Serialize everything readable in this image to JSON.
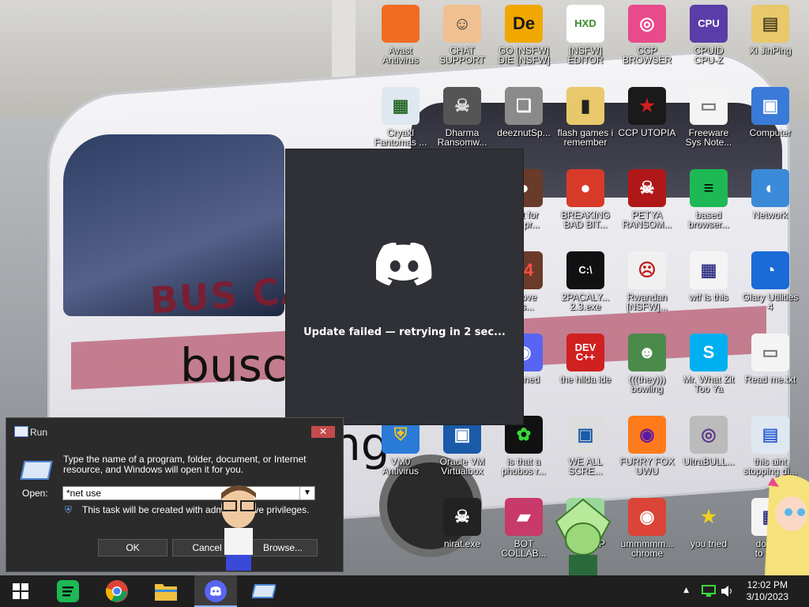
{
  "desktop": {
    "wallpaper_texts": {
      "bus_name": "BUS CAR",
      "line1": "busca",
      "line2": "ng"
    },
    "icons": [
      {
        "name": "avast-antivirus",
        "label": "Avast\nAntivirus",
        "glyph": "",
        "bg": "#f26b21",
        "fg": "#ffffff"
      },
      {
        "name": "chat-support",
        "label": "CHAT\nSUPPORT",
        "glyph": "☺",
        "bg": "#f0c090",
        "fg": "#333333"
      },
      {
        "name": "go-die",
        "label": "GO [NSFW]\nDIE [NSFW]",
        "glyph": "De",
        "bg": "#f0a800",
        "fg": "#1a1a1a"
      },
      {
        "name": "hex-editor",
        "label": "[NSFW] EDITOR",
        "glyph": "HXD",
        "bg": "#ffffff",
        "fg": "#3a8a2a"
      },
      {
        "name": "ccp-browser",
        "label": "CCP\nBROWSER",
        "glyph": "◎",
        "bg": "#e84a8a",
        "fg": "#ffffff"
      },
      {
        "name": "cpuid-cpu-z",
        "label": "CPUID\nCPU-Z",
        "glyph": "CPU",
        "bg": "#5a3da8",
        "fg": "#ffffff"
      },
      {
        "name": "xi-jinping",
        "label": "Xi JinPing",
        "glyph": "▤",
        "bg": "#e8c86a",
        "fg": "#5a4a2a"
      },
      {
        "name": "cryakl-fantomas",
        "label": "Cryakl\nFantomas ...",
        "glyph": "▦",
        "bg": "#dfe8f0",
        "fg": "#2a6a2a"
      },
      {
        "name": "dharma-ransomware",
        "label": "Dharma\nRansomw...",
        "glyph": "☠",
        "bg": "#555555",
        "fg": "#dddddd"
      },
      {
        "name": "deeznutsp",
        "label": "deeznutSp...",
        "glyph": "❏",
        "bg": "#8a8a8a",
        "fg": "#ffffff"
      },
      {
        "name": "flash-games",
        "label": "flash games i\nremember",
        "glyph": "▮",
        "bg": "#e8c86a",
        "fg": "#222222"
      },
      {
        "name": "ccp-utopia",
        "label": "CCP UTOPIA",
        "glyph": "★",
        "bg": "#1a1a1a",
        "fg": "#d02020"
      },
      {
        "name": "freeware-sys-note",
        "label": "Freeware\nSys Note...",
        "glyph": "▭",
        "bg": "#f4f4f4",
        "fg": "#777777"
      },
      {
        "name": "computer",
        "label": "Computer",
        "glyph": "▣",
        "bg": "#3a7ad8",
        "fg": "#ffffff"
      },
      {
        "name": "butt-for-the-pr",
        "label": "butt for\nthe pr...",
        "glyph": "●",
        "bg": "#6a3a2a",
        "fg": "#ffffff"
      },
      {
        "name": "breaking-bad-bit",
        "label": "BREAKING\nBAD BIT...",
        "glyph": "●",
        "bg": "#d83a2a",
        "fg": "#ffffff"
      },
      {
        "name": "petya-ransom",
        "label": "PETYA\nRANSOM...",
        "glyph": "☠",
        "bg": "#b01818",
        "fg": "#ffffff"
      },
      {
        "name": "based-browser",
        "label": "based\nbrowser...",
        "glyph": "≡",
        "bg": "#1db954",
        "fg": "#000000"
      },
      {
        "name": "network",
        "label": "Network",
        "glyph": "◐",
        "bg": "#3a8ad8",
        "fg": "#ffffff"
      },
      {
        "name": "above-s",
        "label": "above\no s...",
        "glyph": "64",
        "bg": "#6a3a2a",
        "fg": "#ff5040"
      },
      {
        "name": "2pacaly",
        "label": "2PACALY...\n2.3.exe",
        "glyph": "C:\\",
        "bg": "#111111",
        "fg": "#ffffff"
      },
      {
        "name": "rwandan-genocide",
        "label": "Rwandan\n[NSFW]...",
        "glyph": "☹",
        "bg": "#f0f0f0",
        "fg": "#c02020"
      },
      {
        "name": "wtf-is-this",
        "label": "wtf is this",
        "glyph": "▦",
        "bg": "#f4f4f4",
        "fg": "#3a3a8a"
      },
      {
        "name": "glary-utilities",
        "label": "Glary Utilities\n4",
        "glyph": "◔",
        "bg": "#1a6ad8",
        "fg": "#ffffff"
      },
      {
        "name": "banned",
        "label": "banned",
        "glyph": "◉",
        "bg": "#5865f2",
        "fg": "#ffffff"
      },
      {
        "name": "the-hilda-ide",
        "label": "the hilda ide",
        "glyph": "DEV\nC++",
        "bg": "#d02020",
        "fg": "#ffffff"
      },
      {
        "name": "they-bowling",
        "label": "(((they)))\nbowling",
        "glyph": "☻",
        "bg": "#4a8a4a",
        "fg": "#ffffff"
      },
      {
        "name": "mr-what-zit-too-ya",
        "label": "Mr. What Zit\nToo Ya",
        "glyph": "S",
        "bg": "#00aff0",
        "fg": "#ffffff"
      },
      {
        "name": "read-me-txt",
        "label": "Read me.txt",
        "glyph": "▭",
        "bg": "#f4f4f4",
        "fg": "#777777"
      },
      {
        "name": "vm0-antivirus",
        "label": "VM0\nAntivirus",
        "glyph": "⛨",
        "bg": "#2a7ad8",
        "fg": "#f0c020"
      },
      {
        "name": "oracle-vm-virtualbox",
        "label": "Oracle VM\nVirtualbox",
        "glyph": "▣",
        "bg": "#1a5aa8",
        "fg": "#ffffff"
      },
      {
        "name": "is-that-a-phobos",
        "label": "is that a\nphobos r...",
        "glyph": "✿",
        "bg": "#111111",
        "fg": "#3ad83a"
      },
      {
        "name": "we-all-scre",
        "label": "WE ALL\nSCRE...",
        "glyph": "▣",
        "bg": "#dddddd",
        "fg": "#1a5aa8"
      },
      {
        "name": "furry-fox-uwu",
        "label": "FURRY FOX\nUWU",
        "glyph": "◉",
        "bg": "#ff7a1a",
        "fg": "#5a1aa8"
      },
      {
        "name": "ultrabull",
        "label": "UltraBULL...",
        "glyph": "◎",
        "bg": "#bbbbbb",
        "fg": "#5a3a8a"
      },
      {
        "name": "this-aint-stopping",
        "label": "this aint\nstopping di...",
        "glyph": "▤",
        "bg": "#dfe8f0",
        "fg": "#3a6ad8"
      },
      {
        "name": "nirat-exe",
        "label": "nirat.exe",
        "glyph": "☠",
        "bg": "#222222",
        "fg": "#ffffff"
      },
      {
        "name": "bot-collab",
        "label": "BOT\nCOLLAB...",
        "glyph": "▰",
        "bg": "#c83a6a",
        "fg": "#ffffff"
      },
      {
        "name": "d-help",
        "label": "D...HELP",
        "glyph": "◆",
        "bg": "#9ad89a",
        "fg": "#1a5a1a"
      },
      {
        "name": "ummmm-chrome",
        "label": "ummmmm...\nchrome",
        "glyph": "◉",
        "bg": "#db4437",
        "fg": "#ffffff"
      },
      {
        "name": "you-tried",
        "label": "you tried",
        "glyph": "★",
        "bg": "transparent",
        "fg": "#f0d020"
      },
      {
        "name": "dont-to-wa",
        "label": "dont ...\nto wa...",
        "glyph": "▦",
        "bg": "#f4f4f4",
        "fg": "#3a3a8a"
      }
    ]
  },
  "discord_updater": {
    "status": "Update failed — retrying in 2 sec..."
  },
  "run_dialog": {
    "title": "Run",
    "close": "✕",
    "description": "Type the name of a program, folder, document, or Internet resource, and Windows will open it for you.",
    "open_label": "Open:",
    "open_value": "*net use",
    "admin_note": "This task will be created with administrative privileges.",
    "ok": "OK",
    "cancel": "Cancel",
    "browse": "Browse..."
  },
  "taskbar": {
    "pinned": [
      "start-button",
      "based-browser-taskbar",
      "chrome-taskbar",
      "file-explorer-taskbar",
      "discord-taskbar",
      "run-taskbar"
    ],
    "active": "discord-taskbar",
    "clock_time": "12:02 PM",
    "clock_date": "3/10/2023"
  },
  "colors": {
    "taskbar": "#1f1f1f",
    "discord_bg": "#2f3136",
    "discord_blurple": "#5865f2",
    "run_bg": "#2b2b2b",
    "close_red": "#c74a4a"
  }
}
